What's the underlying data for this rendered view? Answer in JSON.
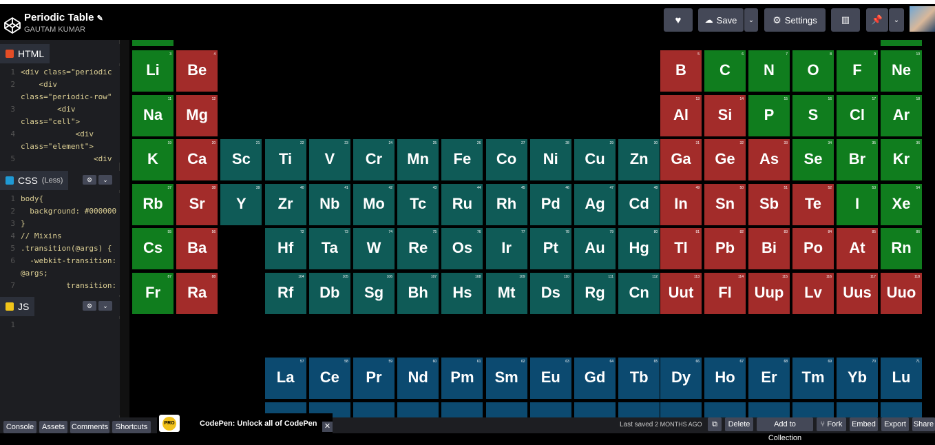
{
  "header": {
    "title": "Periodic Table",
    "author": "GAUTAM KUMAR",
    "save_label": "Save",
    "settings_label": "Settings"
  },
  "editors": {
    "html": {
      "label": "HTML",
      "lines": [
        {
          "n": "1",
          "t": "<div class=\"periodic"
        },
        {
          "n": "2",
          "t": "    <div"
        },
        {
          "n": "",
          "t": "class=\"periodic-row\""
        },
        {
          "n": "3",
          "t": "        <div"
        },
        {
          "n": "",
          "t": "class=\"cell\">"
        },
        {
          "n": "4",
          "t": "            <div"
        },
        {
          "n": "",
          "t": "class=\"element\">"
        },
        {
          "n": "5",
          "t": "                <div"
        }
      ]
    },
    "css": {
      "label": "CSS",
      "sublabel": "(Less)",
      "lines": [
        {
          "n": "1",
          "t": "body{"
        },
        {
          "n": "2",
          "t": "  background: #000000"
        },
        {
          "n": "3",
          "t": "}"
        },
        {
          "n": "4",
          "t": "// Mixins"
        },
        {
          "n": "5",
          "t": ".transition(@args) {"
        },
        {
          "n": "6",
          "t": "  -webkit-transition:"
        },
        {
          "n": "",
          "t": "@args;"
        },
        {
          "n": "7",
          "t": "          transition:"
        }
      ]
    },
    "js": {
      "label": "JS",
      "lines": [
        {
          "n": "1",
          "t": ""
        }
      ]
    }
  },
  "elements": [
    {
      "s": "Li",
      "n": "3",
      "c": "g",
      "col": 0,
      "row": 0
    },
    {
      "s": "Be",
      "n": "4",
      "c": "r",
      "col": 1,
      "row": 0
    },
    {
      "s": "Na",
      "n": "11",
      "c": "g",
      "col": 0,
      "row": 1
    },
    {
      "s": "Mg",
      "n": "12",
      "c": "r",
      "col": 1,
      "row": 1
    },
    {
      "s": "K",
      "n": "19",
      "c": "g",
      "col": 0,
      "row": 2
    },
    {
      "s": "Ca",
      "n": "20",
      "c": "r",
      "col": 1,
      "row": 2
    },
    {
      "s": "Sc",
      "n": "21",
      "c": "t",
      "col": 2,
      "row": 2
    },
    {
      "s": "Ti",
      "n": "22",
      "c": "t",
      "col": 3,
      "row": 2
    },
    {
      "s": "V",
      "n": "23",
      "c": "t",
      "col": 4,
      "row": 2
    },
    {
      "s": "Cr",
      "n": "24",
      "c": "t",
      "col": 5,
      "row": 2
    },
    {
      "s": "Mn",
      "n": "25",
      "c": "t",
      "col": 6,
      "row": 2
    },
    {
      "s": "Fe",
      "n": "26",
      "c": "t",
      "col": 7,
      "row": 2
    },
    {
      "s": "Co",
      "n": "27",
      "c": "t",
      "col": 8,
      "row": 2
    },
    {
      "s": "Ni",
      "n": "28",
      "c": "t",
      "col": 9,
      "row": 2
    },
    {
      "s": "Cu",
      "n": "29",
      "c": "t",
      "col": 10,
      "row": 2
    },
    {
      "s": "Zn",
      "n": "30",
      "c": "t",
      "col": 11,
      "row": 2
    },
    {
      "s": "Rb",
      "n": "37",
      "c": "g",
      "col": 0,
      "row": 3
    },
    {
      "s": "Sr",
      "n": "38",
      "c": "r",
      "col": 1,
      "row": 3
    },
    {
      "s": "Y",
      "n": "39",
      "c": "t",
      "col": 2,
      "row": 3
    },
    {
      "s": "Zr",
      "n": "40",
      "c": "t",
      "col": 3,
      "row": 3
    },
    {
      "s": "Nb",
      "n": "41",
      "c": "t",
      "col": 4,
      "row": 3
    },
    {
      "s": "Mo",
      "n": "42",
      "c": "t",
      "col": 5,
      "row": 3
    },
    {
      "s": "Tc",
      "n": "43",
      "c": "t",
      "col": 6,
      "row": 3
    },
    {
      "s": "Ru",
      "n": "44",
      "c": "t",
      "col": 7,
      "row": 3
    },
    {
      "s": "Rh",
      "n": "45",
      "c": "t",
      "col": 8,
      "row": 3
    },
    {
      "s": "Pd",
      "n": "46",
      "c": "t",
      "col": 9,
      "row": 3
    },
    {
      "s": "Ag",
      "n": "47",
      "c": "t",
      "col": 10,
      "row": 3
    },
    {
      "s": "Cd",
      "n": "48",
      "c": "t",
      "col": 11,
      "row": 3
    },
    {
      "s": "Cs",
      "n": "55",
      "c": "g",
      "col": 0,
      "row": 4
    },
    {
      "s": "Ba",
      "n": "56",
      "c": "r",
      "col": 1,
      "row": 4
    },
    {
      "s": "Hf",
      "n": "72",
      "c": "t",
      "col": 3,
      "row": 4
    },
    {
      "s": "Ta",
      "n": "73",
      "c": "t",
      "col": 4,
      "row": 4
    },
    {
      "s": "W",
      "n": "74",
      "c": "t",
      "col": 5,
      "row": 4
    },
    {
      "s": "Re",
      "n": "75",
      "c": "t",
      "col": 6,
      "row": 4
    },
    {
      "s": "Os",
      "n": "76",
      "c": "t",
      "col": 7,
      "row": 4
    },
    {
      "s": "Ir",
      "n": "77",
      "c": "t",
      "col": 8,
      "row": 4
    },
    {
      "s": "Pt",
      "n": "78",
      "c": "t",
      "col": 9,
      "row": 4
    },
    {
      "s": "Au",
      "n": "79",
      "c": "t",
      "col": 10,
      "row": 4
    },
    {
      "s": "Hg",
      "n": "80",
      "c": "t",
      "col": 11,
      "row": 4
    },
    {
      "s": "Fr",
      "n": "87",
      "c": "g",
      "col": 0,
      "row": 5
    },
    {
      "s": "Ra",
      "n": "88",
      "c": "r",
      "col": 1,
      "row": 5
    },
    {
      "s": "Rf",
      "n": "104",
      "c": "t",
      "col": 3,
      "row": 5
    },
    {
      "s": "Db",
      "n": "105",
      "c": "t",
      "col": 4,
      "row": 5
    },
    {
      "s": "Sg",
      "n": "106",
      "c": "t",
      "col": 5,
      "row": 5
    },
    {
      "s": "Bh",
      "n": "107",
      "c": "t",
      "col": 6,
      "row": 5
    },
    {
      "s": "Hs",
      "n": "108",
      "c": "t",
      "col": 7,
      "row": 5
    },
    {
      "s": "Mt",
      "n": "109",
      "c": "t",
      "col": 8,
      "row": 5
    },
    {
      "s": "Ds",
      "n": "110",
      "c": "t",
      "col": 9,
      "row": 5
    },
    {
      "s": "Rg",
      "n": "111",
      "c": "t",
      "col": 10,
      "row": 5
    },
    {
      "s": "Cn",
      "n": "112",
      "c": "t",
      "col": 11,
      "row": 5
    },
    {
      "s": "B",
      "n": "5",
      "c": "r",
      "col": 12,
      "row": 0
    },
    {
      "s": "C",
      "n": "6",
      "c": "g",
      "col": 13,
      "row": 0
    },
    {
      "s": "N",
      "n": "7",
      "c": "g",
      "col": 14,
      "row": 0
    },
    {
      "s": "O",
      "n": "8",
      "c": "g",
      "col": 15,
      "row": 0
    },
    {
      "s": "F",
      "n": "9",
      "c": "g",
      "col": 16,
      "row": 0
    },
    {
      "s": "Ne",
      "n": "10",
      "c": "g",
      "col": 17,
      "row": 0
    },
    {
      "s": "Al",
      "n": "13",
      "c": "r",
      "col": 12,
      "row": 1
    },
    {
      "s": "Si",
      "n": "14",
      "c": "r",
      "col": 13,
      "row": 1
    },
    {
      "s": "P",
      "n": "15",
      "c": "g",
      "col": 14,
      "row": 1
    },
    {
      "s": "S",
      "n": "16",
      "c": "g",
      "col": 15,
      "row": 1
    },
    {
      "s": "Cl",
      "n": "17",
      "c": "g",
      "col": 16,
      "row": 1
    },
    {
      "s": "Ar",
      "n": "18",
      "c": "g",
      "col": 17,
      "row": 1
    },
    {
      "s": "Ga",
      "n": "31",
      "c": "r",
      "col": 12,
      "row": 2
    },
    {
      "s": "Ge",
      "n": "32",
      "c": "r",
      "col": 13,
      "row": 2
    },
    {
      "s": "As",
      "n": "33",
      "c": "r",
      "col": 14,
      "row": 2
    },
    {
      "s": "Se",
      "n": "34",
      "c": "g",
      "col": 15,
      "row": 2
    },
    {
      "s": "Br",
      "n": "35",
      "c": "g",
      "col": 16,
      "row": 2
    },
    {
      "s": "Kr",
      "n": "36",
      "c": "g",
      "col": 17,
      "row": 2
    },
    {
      "s": "In",
      "n": "49",
      "c": "r",
      "col": 12,
      "row": 3
    },
    {
      "s": "Sn",
      "n": "50",
      "c": "r",
      "col": 13,
      "row": 3
    },
    {
      "s": "Sb",
      "n": "51",
      "c": "r",
      "col": 14,
      "row": 3
    },
    {
      "s": "Te",
      "n": "52",
      "c": "r",
      "col": 15,
      "row": 3
    },
    {
      "s": "I",
      "n": "53",
      "c": "g",
      "col": 16,
      "row": 3
    },
    {
      "s": "Xe",
      "n": "54",
      "c": "g",
      "col": 17,
      "row": 3
    },
    {
      "s": "Tl",
      "n": "81",
      "c": "r",
      "col": 12,
      "row": 4
    },
    {
      "s": "Pb",
      "n": "82",
      "c": "r",
      "col": 13,
      "row": 4
    },
    {
      "s": "Bi",
      "n": "83",
      "c": "r",
      "col": 14,
      "row": 4
    },
    {
      "s": "Po",
      "n": "84",
      "c": "r",
      "col": 15,
      "row": 4
    },
    {
      "s": "At",
      "n": "85",
      "c": "r",
      "col": 16,
      "row": 4
    },
    {
      "s": "Rn",
      "n": "86",
      "c": "g",
      "col": 17,
      "row": 4
    },
    {
      "s": "Uut",
      "n": "113",
      "c": "r",
      "col": 12,
      "row": 5
    },
    {
      "s": "Fl",
      "n": "114",
      "c": "r",
      "col": 13,
      "row": 5
    },
    {
      "s": "Uup",
      "n": "115",
      "c": "r",
      "col": 14,
      "row": 5
    },
    {
      "s": "Lv",
      "n": "116",
      "c": "r",
      "col": 15,
      "row": 5
    },
    {
      "s": "Uus",
      "n": "117",
      "c": "r",
      "col": 16,
      "row": 5
    },
    {
      "s": "Uuo",
      "n": "118",
      "c": "r",
      "col": 17,
      "row": 5
    },
    {
      "s": "La",
      "n": "57",
      "c": "b",
      "col": 3,
      "row": 8
    },
    {
      "s": "Ce",
      "n": "58",
      "c": "b",
      "col": 4,
      "row": 8
    },
    {
      "s": "Pr",
      "n": "59",
      "c": "b",
      "col": 5,
      "row": 8
    },
    {
      "s": "Nd",
      "n": "60",
      "c": "b",
      "col": 6,
      "row": 8
    },
    {
      "s": "Pm",
      "n": "61",
      "c": "b",
      "col": 7,
      "row": 8
    },
    {
      "s": "Sm",
      "n": "62",
      "c": "b",
      "col": 8,
      "row": 8
    },
    {
      "s": "Eu",
      "n": "63",
      "c": "b",
      "col": 9,
      "row": 8
    },
    {
      "s": "Gd",
      "n": "64",
      "c": "b",
      "col": 10,
      "row": 8
    },
    {
      "s": "Tb",
      "n": "65",
      "c": "b",
      "col": 11,
      "row": 8
    },
    {
      "s": "Dy",
      "n": "66",
      "c": "b",
      "col": 12,
      "row": 8
    },
    {
      "s": "Ho",
      "n": "67",
      "c": "b",
      "col": 13,
      "row": 8
    },
    {
      "s": "Er",
      "n": "68",
      "c": "b",
      "col": 14,
      "row": 8
    },
    {
      "s": "Tm",
      "n": "69",
      "c": "b",
      "col": 15,
      "row": 8
    },
    {
      "s": "Yb",
      "n": "70",
      "c": "b",
      "col": 16,
      "row": 8
    },
    {
      "s": "Lu",
      "n": "71",
      "c": "b",
      "col": 17,
      "row": 8
    }
  ],
  "colors": {
    "g": "#107d1e",
    "r": "#a32c2a",
    "t": "#0f5b57",
    "b": "#0c4a70"
  },
  "footer": {
    "console": "Console",
    "assets": "Assets",
    "comments": "Comments",
    "shortcuts": "Shortcuts",
    "pro_badge": "PRO",
    "promo": "CodePen: Unlock all of CodePen",
    "last_saved_prefix": "Last saved",
    "last_saved_value": "2 MONTHS AGO",
    "delete": "Delete",
    "add_to_collection": "Add to Collection",
    "fork": "Fork",
    "embed": "Embed",
    "export": "Export",
    "share": "Share"
  }
}
